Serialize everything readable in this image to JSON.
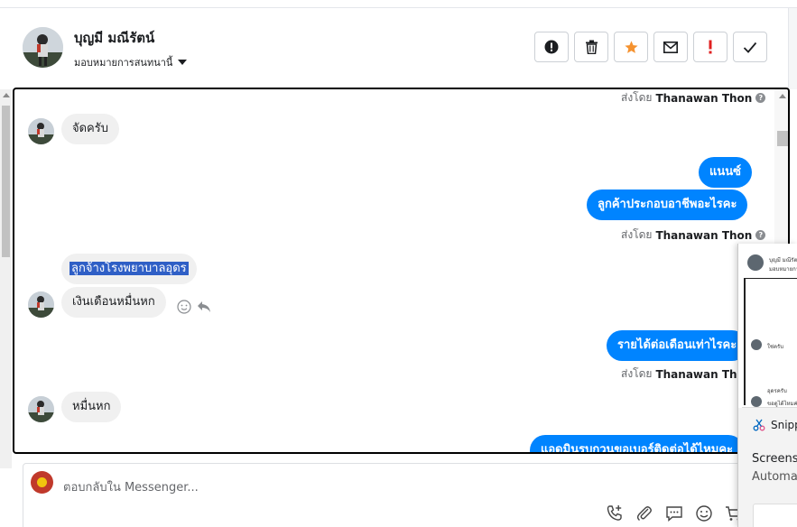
{
  "header": {
    "contact_name": "บุญมี มณีรัตน์",
    "assign_label": "มอบหมายการสนทนานี้",
    "actions": [
      {
        "name": "report-spam-icon",
        "color": "#1c1e21"
      },
      {
        "name": "trash-icon",
        "color": "#1c1e21"
      },
      {
        "name": "star-icon",
        "color": "#f5922f"
      },
      {
        "name": "mail-icon",
        "color": "#1c1e21"
      },
      {
        "name": "priority-icon",
        "color": "#e02020"
      },
      {
        "name": "check-icon",
        "color": "#1c1e21"
      }
    ]
  },
  "conversation": {
    "sent_by_prefix": "ส่งโดย",
    "agent_name": "Thanawan Thon",
    "messages": {
      "m1": "จัดครับ",
      "m2": "แนนซ์",
      "m3": "ลูกค้าประกอบอาชีพอะไรคะ",
      "m4": "ลูกจ้างโรงพยาบาลอุดร",
      "m5": "เงินเดือนหมื่นหก",
      "m6": "รายได้ต่อเดือนเท่าไรคะ",
      "m7": "หมื่นหก",
      "m8": "แอดมินรบกวนขอเบอร์ติดต่อได้ไหมคะ"
    },
    "accent_color": "#0084ff"
  },
  "reply": {
    "placeholder": "ตอบกลับใน Messenger...",
    "tools": [
      "phone-plus-icon",
      "paperclip-icon",
      "saved-reply-icon",
      "emoji-icon",
      "cart-icon"
    ]
  },
  "overlay": {
    "thumb_name": "บุญมี มณีรัตน์",
    "thumb_sub": "มอบหมายการสน",
    "thumb_msg1": "ใช่ครับ",
    "thumb_msg2": "อุดรครับ",
    "thumb_msg3": "ขอดูได้ไหมค่ะ",
    "snip_label": "Snipp",
    "title": "Screensh",
    "subtitle": "Automat"
  }
}
